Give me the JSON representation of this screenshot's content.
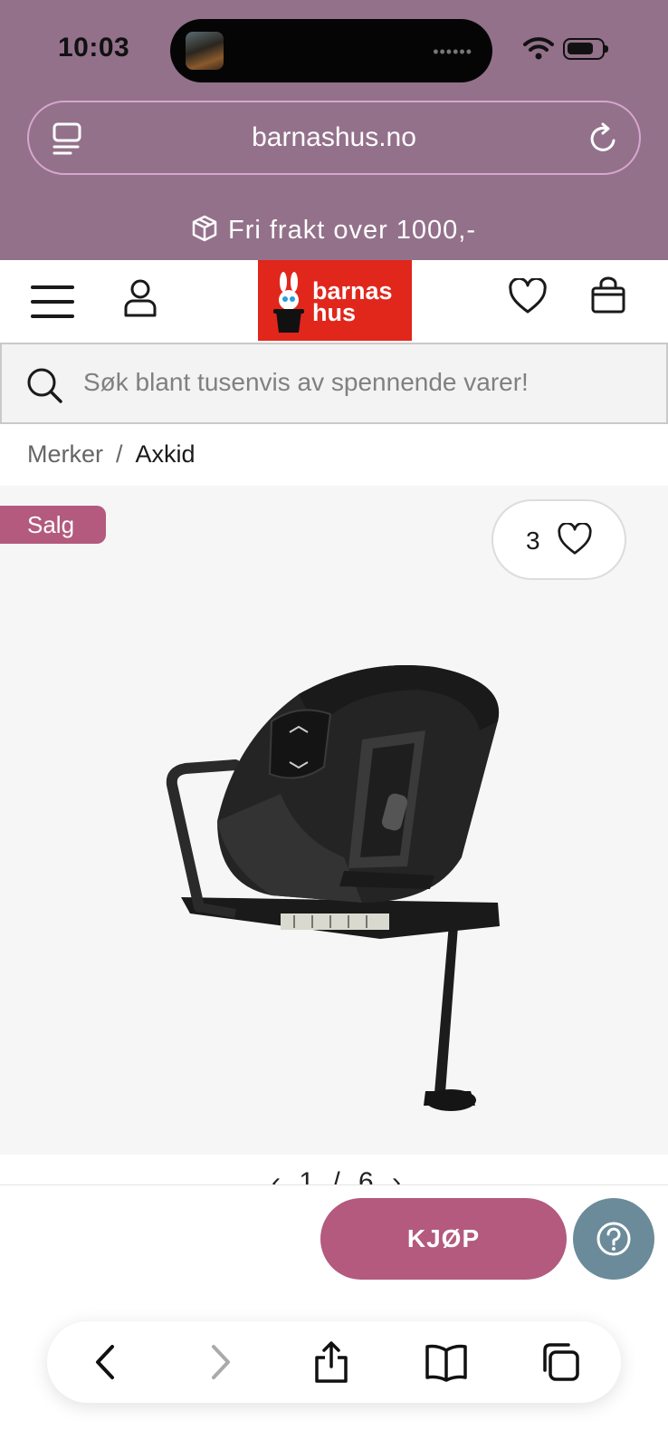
{
  "status_bar": {
    "time": "10:03",
    "island_indicator": "••••••"
  },
  "browser": {
    "url": "barnashus.no",
    "icons": [
      "tabs-icon",
      "reload-icon"
    ],
    "toolbar_icons": [
      "back-icon",
      "forward-icon",
      "share-icon",
      "bookmarks-icon",
      "tabs-icon"
    ]
  },
  "banner": {
    "shipping_text": "Fri frakt over 1000,-"
  },
  "header": {
    "logo_line1": "barnas",
    "logo_line2": "hus",
    "icons": [
      "menu-icon",
      "user-icon",
      "heart-icon",
      "bag-icon"
    ]
  },
  "search": {
    "placeholder": "Søk blant tusenvis av spennende varer!"
  },
  "breadcrumb": {
    "parent": "Merker",
    "separator": "/",
    "current": "Axkid"
  },
  "product": {
    "badge": "Salg",
    "wishlist_count": "3",
    "pager": "‹ 1 / 6 ›"
  },
  "actions": {
    "buy_label": "KJØP"
  },
  "colors": {
    "top_bg": "#93718a",
    "url_border": "#d7a6cf",
    "logo_red": "#e1261c",
    "accent_pink": "#b35a7e",
    "help_blue": "#6b8b9a"
  }
}
